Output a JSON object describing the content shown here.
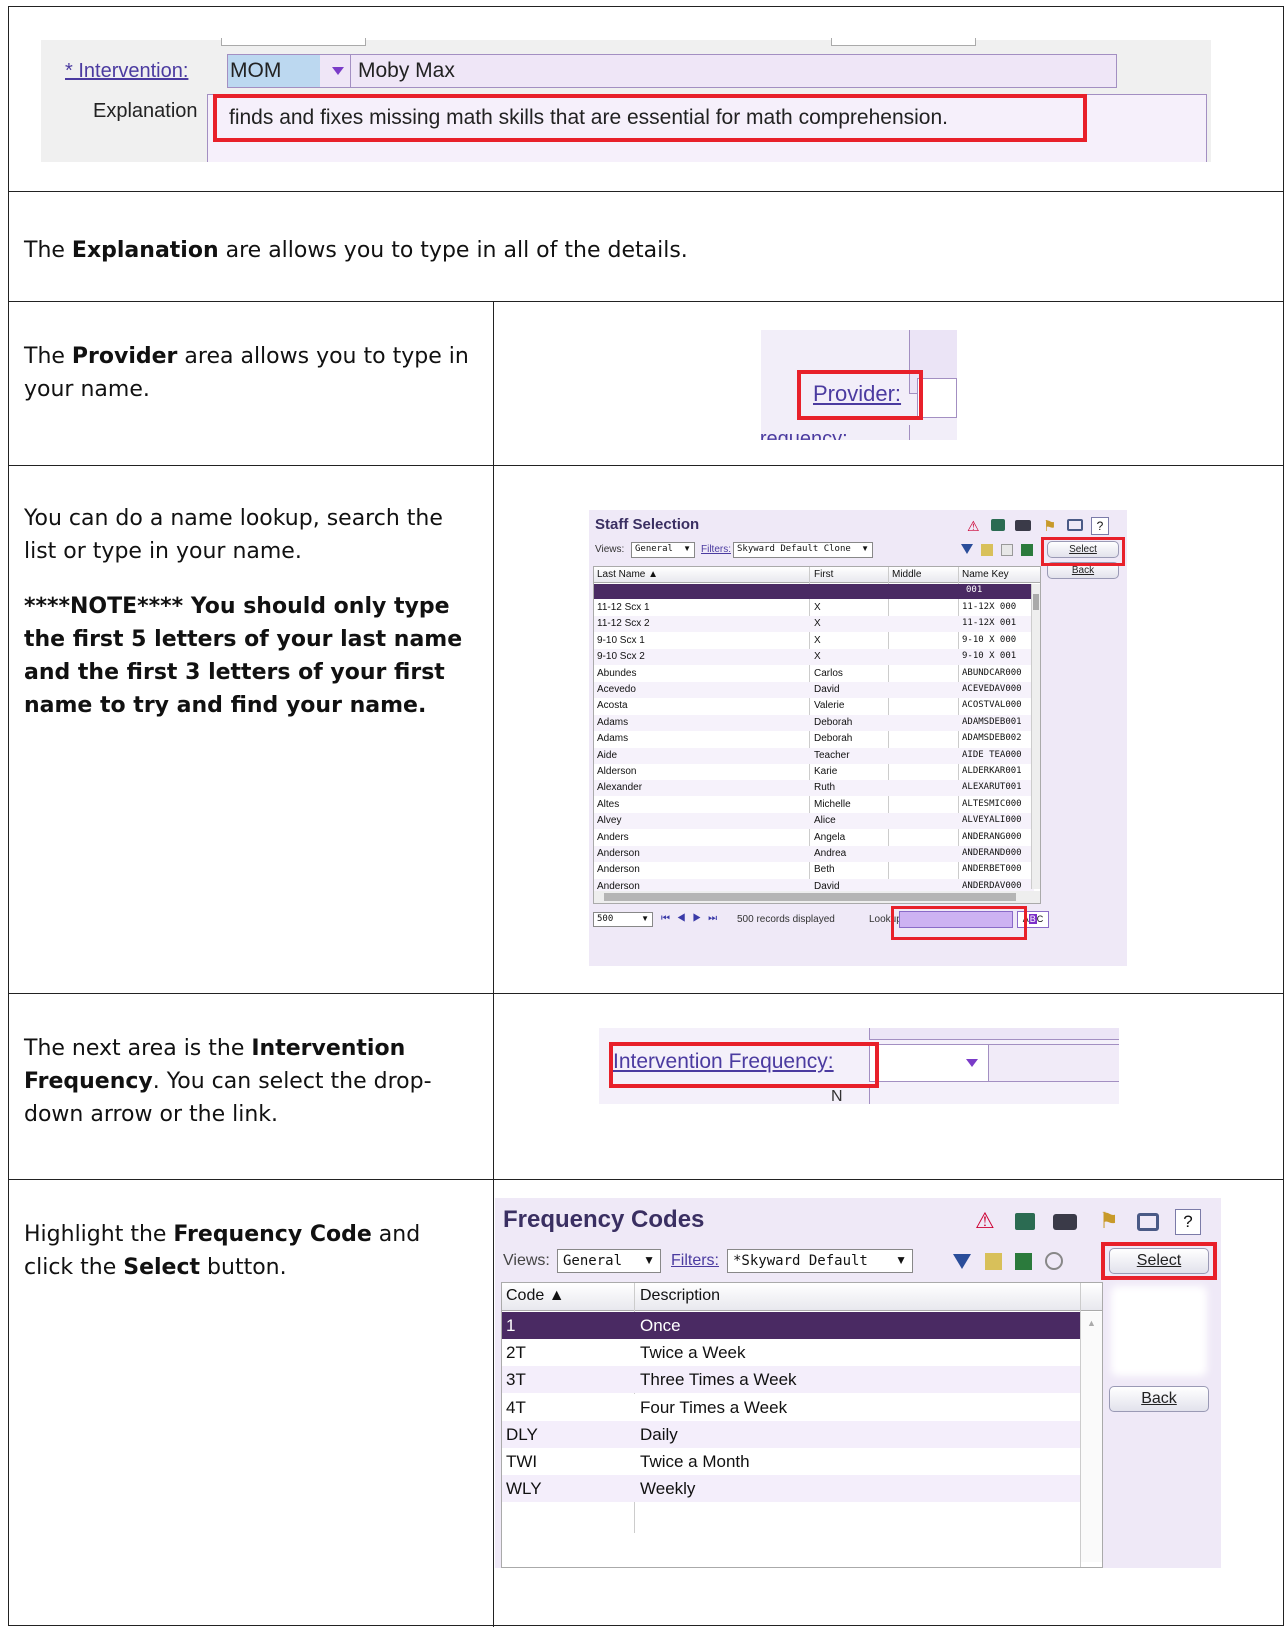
{
  "section1": {
    "intervention_label": "* Intervention:",
    "intervention_code": "MOM",
    "intervention_name": "Moby Max",
    "explanation_label": "Explanation",
    "explanation_value": "finds and fixes missing math skills that are essential for math comprehension."
  },
  "section2": {
    "pre": "The ",
    "bold": "Explanation",
    "post": " are allows you to type in all of the details."
  },
  "section3": {
    "pre": "The ",
    "bold": "Provider",
    "post": " area allows you to type in your name.",
    "provider_label": "Provider:",
    "frequency_partial": "n Frequency:"
  },
  "section4": {
    "text": "You can do a name lookup, search the list or type in your name.",
    "note": "****NOTE**** You should only type the first 5 letters of your last name and the first 3 letters of your first name to try and find your name.",
    "window_title": "Staff Selection",
    "views_label": "Views:",
    "views_value": "General",
    "filters_label": "Filters:",
    "filters_value": "Skyward Default Clone",
    "select_label": "Select",
    "back_label": "Back",
    "columns": [
      "Last Name ▲",
      "First",
      "Middle",
      "Name Key"
    ],
    "selected_key": "001",
    "rows": [
      [
        "11-12 Scx 1",
        "X",
        "",
        "11-12X 000"
      ],
      [
        "11-12 Scx 2",
        "X",
        "",
        "11-12X 001"
      ],
      [
        "9-10 Scx 1",
        "X",
        "",
        "9-10 X 000"
      ],
      [
        "9-10 Scx 2",
        "X",
        "",
        "9-10 X 001"
      ],
      [
        "Abundes",
        "Carlos",
        "",
        "ABUNDCAR000"
      ],
      [
        "Acevedo",
        "David",
        "",
        "ACEVEDAV000"
      ],
      [
        "Acosta",
        "Valerie",
        "",
        "ACOSTVAL000"
      ],
      [
        "Adams",
        "Deborah",
        "",
        "ADAMSDEB001"
      ],
      [
        "Adams",
        "Deborah",
        "",
        "ADAMSDEB002"
      ],
      [
        "Aide",
        "Teacher",
        "",
        "AIDE TEA000"
      ],
      [
        "Alderson",
        "Karie",
        "",
        "ALDERKAR001"
      ],
      [
        "Alexander",
        "Ruth",
        "",
        "ALEXARUT001"
      ],
      [
        "Altes",
        "Michelle",
        "",
        "ALTESMIC000"
      ],
      [
        "Alvey",
        "Alice",
        "",
        "ALVEYALI000"
      ],
      [
        "Anders",
        "Angela",
        "",
        "ANDERANG000"
      ],
      [
        "Anderson",
        "Andrea",
        "",
        "ANDERAND000"
      ],
      [
        "Anderson",
        "Beth",
        "",
        "ANDERBET000"
      ],
      [
        "Anderson",
        "David",
        "",
        "ANDERDAV000"
      ]
    ],
    "page_size": "500",
    "records_text": "500 records displayed",
    "lookup_label": "Lookup:",
    "abc": [
      "A",
      "B",
      "C"
    ]
  },
  "section5": {
    "pre": "The next area is the ",
    "bold": "Intervention Frequency",
    "post": ".  You can select the drop-down arrow or the link.",
    "link_label": "Intervention Frequency:",
    "partial_below": "N"
  },
  "section6": {
    "pre": "Highlight the ",
    "bold1": "Frequency Code",
    "mid": " and click the ",
    "bold2": "Select",
    "post": " button.",
    "window_title": "Frequency Codes",
    "views_label": "Views:",
    "views_value": "General",
    "filters_label": "Filters:",
    "filters_value": "*Skyward Default",
    "select_label": "Select",
    "back_label": "Back",
    "columns": [
      "Code ▲",
      "Description"
    ],
    "rows": [
      [
        "1",
        "Once"
      ],
      [
        "2T",
        "Twice a Week"
      ],
      [
        "3T",
        "Three Times a Week"
      ],
      [
        "4T",
        "Four Times a Week"
      ],
      [
        "DLY",
        "Daily"
      ],
      [
        "TWI",
        "Twice a Month"
      ],
      [
        "WLY",
        "Weekly"
      ]
    ]
  },
  "colors": {
    "highlight_red": "#e8202a",
    "selected_row": "#4a2a63",
    "lavender": "#ede8f7",
    "link": "#4b3ba0"
  }
}
